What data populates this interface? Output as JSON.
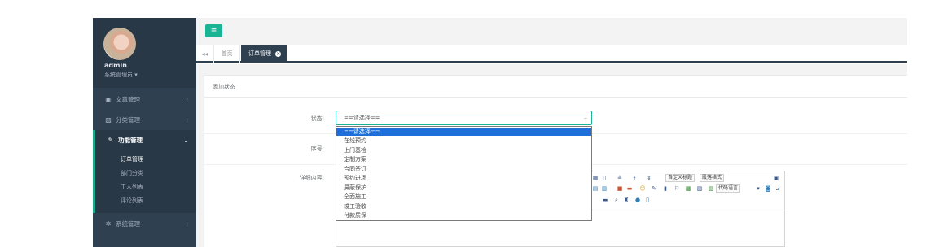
{
  "sidebar": {
    "user": {
      "name": "admin",
      "role": "系统管理员 ▾"
    },
    "menu": [
      {
        "label": "文章管理",
        "icon": "▣",
        "arrow": "‹"
      },
      {
        "label": "分类管理",
        "icon": "▨",
        "arrow": "‹"
      },
      {
        "label": "功能管理",
        "icon": "✎",
        "arrow": "⌄"
      },
      {
        "label": "系统管理",
        "icon": "✲",
        "arrow": "‹"
      }
    ],
    "submenu": [
      "订单管理",
      "部门分类",
      "工人列表",
      "评论列表"
    ]
  },
  "topbar": {
    "menu_icon": "≡"
  },
  "tabs": {
    "back": "◂◂",
    "home": "首页",
    "current": "订单管理",
    "close": "×"
  },
  "panel": {
    "title": "添加状态"
  },
  "form": {
    "status_label": "状态:",
    "status_value": "==请选择==",
    "order_label": "序号:",
    "detail_label": "详细内容:"
  },
  "dropdown_options": [
    "==请选择==",
    "在线预约",
    "上门基检",
    "定制方案",
    "合同签订",
    "预约进场",
    "屏蔽保护",
    "全面施工",
    "竣工验收",
    "付款质保"
  ],
  "editor": {
    "custom_title": "自定义标题",
    "paragraph_format": "段落格式",
    "code_lang": "代码语言"
  },
  "colors": {
    "sidebar": "#2f4050",
    "accent": "#1ab394",
    "selected": "#1e6fd9"
  }
}
